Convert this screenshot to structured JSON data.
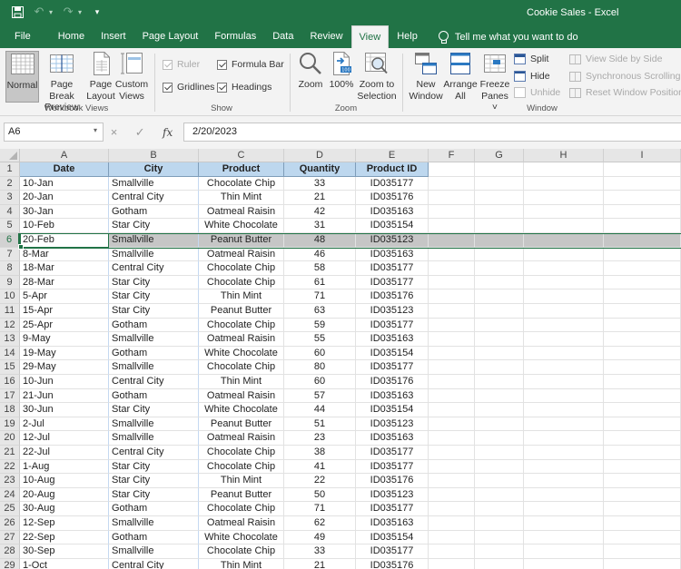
{
  "window": {
    "title": "Cookie Sales  -  Excel"
  },
  "qat": {
    "save_icon": "save-icon",
    "undo_icon": "undo-icon",
    "redo_icon": "redo-icon",
    "customize_icon": "customize-qat-icon"
  },
  "tabs": [
    {
      "label": "File",
      "active": false
    },
    {
      "label": "Home",
      "active": false
    },
    {
      "label": "Insert",
      "active": false
    },
    {
      "label": "Page Layout",
      "active": false
    },
    {
      "label": "Formulas",
      "active": false
    },
    {
      "label": "Data",
      "active": false
    },
    {
      "label": "Review",
      "active": false
    },
    {
      "label": "View",
      "active": true
    },
    {
      "label": "Help",
      "active": false
    }
  ],
  "tell_me": {
    "placeholder": "Tell me what you want to do",
    "icon": "lightbulb-icon"
  },
  "ribbon": {
    "workbook_views": {
      "label": "Workbook Views",
      "normal": {
        "line1": "Normal",
        "line2": "",
        "pressed": true
      },
      "page_break": {
        "line1": "Page Break",
        "line2": "Preview"
      },
      "page_layout": {
        "line1": "Page",
        "line2": "Layout"
      },
      "custom_views": {
        "line1": "Custom",
        "line2": "Views"
      }
    },
    "show": {
      "label": "Show",
      "ruler": {
        "label": "Ruler",
        "checked": true,
        "disabled": true
      },
      "formula_bar": {
        "label": "Formula Bar",
        "checked": true
      },
      "gridlines": {
        "label": "Gridlines",
        "checked": true
      },
      "headings": {
        "label": "Headings",
        "checked": true
      }
    },
    "zoom": {
      "label": "Zoom",
      "zoom": {
        "line1": "Zoom",
        "line2": ""
      },
      "hundred": {
        "line1": "100%",
        "line2": "",
        "badge": "100"
      },
      "zoom_selection": {
        "line1": "Zoom to",
        "line2": "Selection"
      }
    },
    "window": {
      "label": "Window",
      "new_window": {
        "line1": "New",
        "line2": "Window"
      },
      "arrange_all": {
        "line1": "Arrange",
        "line2": "All"
      },
      "freeze_panes": {
        "line1": "Freeze",
        "line2": "Panes ˅"
      },
      "split": "Split",
      "hide": "Hide",
      "unhide": "Unhide",
      "view_side": "View Side by Side",
      "sync_scroll": "Synchronous Scrolling",
      "reset_pos": "Reset Window Position"
    }
  },
  "formula_bar": {
    "name_box": "A6",
    "cancel_icon": "×",
    "enter_icon": "✓",
    "fx_label": "fx",
    "value": "2/20/2023"
  },
  "sheet": {
    "column_letters": [
      "A",
      "B",
      "C",
      "D",
      "E",
      "F",
      "G",
      "H",
      "I"
    ],
    "selected_row": 6,
    "active_cell": "A6",
    "headers": [
      "Date",
      "City",
      "Product",
      "Quantity",
      "Product ID"
    ],
    "rows": [
      [
        "10-Jan",
        "Smallville",
        "Chocolate Chip",
        "33",
        "ID035177"
      ],
      [
        "20-Jan",
        "Central City",
        "Thin Mint",
        "21",
        "ID035176"
      ],
      [
        "30-Jan",
        "Gotham",
        "Oatmeal Raisin",
        "42",
        "ID035163"
      ],
      [
        "10-Feb",
        "Star City",
        "White Chocolate",
        "31",
        "ID035154"
      ],
      [
        "20-Feb",
        "Smallville",
        "Peanut Butter",
        "48",
        "ID035123"
      ],
      [
        "8-Mar",
        "Smallville",
        "Oatmeal Raisin",
        "46",
        "ID035163"
      ],
      [
        "18-Mar",
        "Central City",
        "Chocolate Chip",
        "58",
        "ID035177"
      ],
      [
        "28-Mar",
        "Star City",
        "Chocolate Chip",
        "61",
        "ID035177"
      ],
      [
        "5-Apr",
        "Star City",
        "Thin Mint",
        "71",
        "ID035176"
      ],
      [
        "15-Apr",
        "Star City",
        "Peanut Butter",
        "63",
        "ID035123"
      ],
      [
        "25-Apr",
        "Gotham",
        "Chocolate Chip",
        "59",
        "ID035177"
      ],
      [
        "9-May",
        "Smallville",
        "Oatmeal Raisin",
        "55",
        "ID035163"
      ],
      [
        "19-May",
        "Gotham",
        "White Chocolate",
        "60",
        "ID035154"
      ],
      [
        "29-May",
        "Smallville",
        "Chocolate Chip",
        "80",
        "ID035177"
      ],
      [
        "10-Jun",
        "Central City",
        "Thin Mint",
        "60",
        "ID035176"
      ],
      [
        "21-Jun",
        "Gotham",
        "Oatmeal Raisin",
        "57",
        "ID035163"
      ],
      [
        "30-Jun",
        "Star City",
        "White Chocolate",
        "44",
        "ID035154"
      ],
      [
        "2-Jul",
        "Smallville",
        "Peanut Butter",
        "51",
        "ID035123"
      ],
      [
        "12-Jul",
        "Smallville",
        "Oatmeal Raisin",
        "23",
        "ID035163"
      ],
      [
        "22-Jul",
        "Central City",
        "Chocolate Chip",
        "38",
        "ID035177"
      ],
      [
        "1-Aug",
        "Star City",
        "Chocolate Chip",
        "41",
        "ID035177"
      ],
      [
        "10-Aug",
        "Star City",
        "Thin Mint",
        "22",
        "ID035176"
      ],
      [
        "20-Aug",
        "Star City",
        "Peanut Butter",
        "50",
        "ID035123"
      ],
      [
        "30-Aug",
        "Gotham",
        "Chocolate Chip",
        "71",
        "ID035177"
      ],
      [
        "12-Sep",
        "Smallville",
        "Oatmeal Raisin",
        "62",
        "ID035163"
      ],
      [
        "22-Sep",
        "Gotham",
        "White Chocolate",
        "49",
        "ID035154"
      ],
      [
        "30-Sep",
        "Smallville",
        "Chocolate Chip",
        "33",
        "ID035177"
      ],
      [
        "1-Oct",
        "Central City",
        "Thin Mint",
        "21",
        "ID035176"
      ]
    ]
  },
  "colors": {
    "brand": "#217346",
    "header_fill": "#bdd7ee",
    "selected_row_fill": "#c6c6c6"
  }
}
